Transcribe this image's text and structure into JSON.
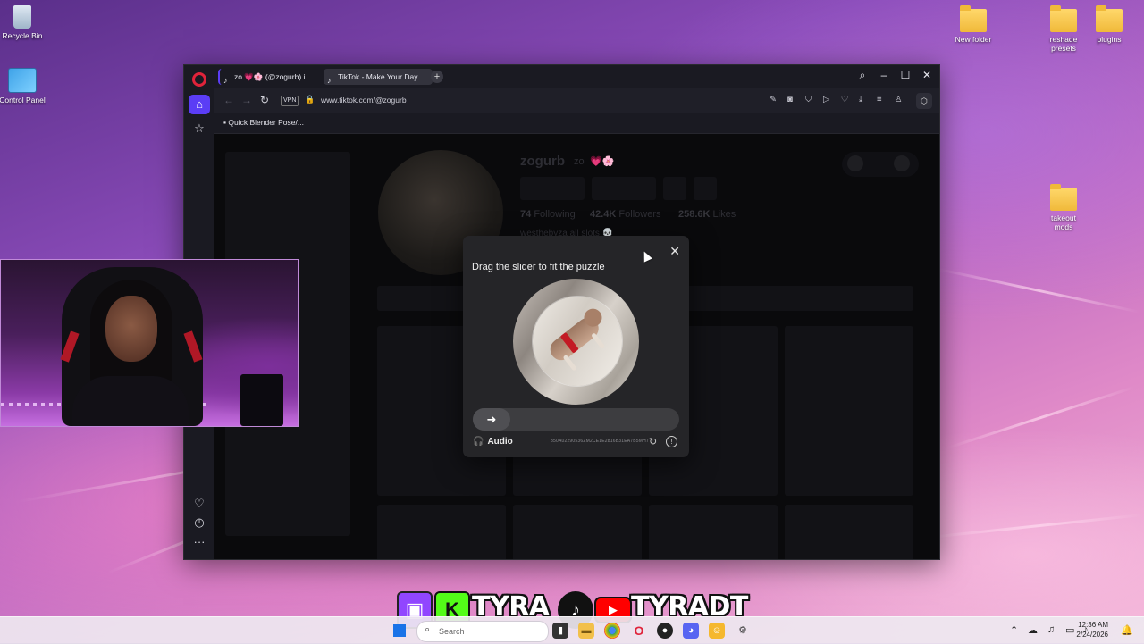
{
  "desktop": {
    "icons": [
      {
        "label": "Recycle Bin"
      },
      {
        "label": "Control Panel"
      },
      {
        "label": "New folder"
      },
      {
        "label": "reshade presets"
      },
      {
        "label": "plugins"
      },
      {
        "label": "takeout mods"
      }
    ]
  },
  "browser": {
    "tabs": [
      {
        "label": "zo 💗🌸 (@zogurb) i"
      },
      {
        "label": "TikTok - Make Your Day"
      }
    ],
    "vpn_label": "VPN",
    "url": "www.tiktok.com/@zogurb",
    "bookmark": "Quick Blender Pose/..."
  },
  "profile": {
    "username": "zogurb",
    "nickname": "zo",
    "emoji": "💗🌸",
    "following_count": "74",
    "following_label": "Following",
    "followers_count": "42.4K",
    "followers_label": "Followers",
    "likes_count": "258.6K",
    "likes_label": "Likes",
    "bio": "westhebyza all slots 💀"
  },
  "captcha": {
    "title": "Drag the slider to fit the puzzle",
    "audio_label": "Audio",
    "id_text": "350A02290536ZM2CE1E2816B31EA7B5MH7",
    "slider_progress": 0
  },
  "banner": {
    "name": "TYRA",
    "handle": "TYRADT"
  },
  "taskbar": {
    "search_placeholder": "Search",
    "time": "12:36 AM",
    "date": "2/24/2026"
  },
  "colors": {
    "opera_accent": "#5b3df5",
    "opera_red": "#e0233a",
    "twitch": "#9146ff",
    "kick": "#53fc18",
    "youtube": "#ff0000"
  }
}
